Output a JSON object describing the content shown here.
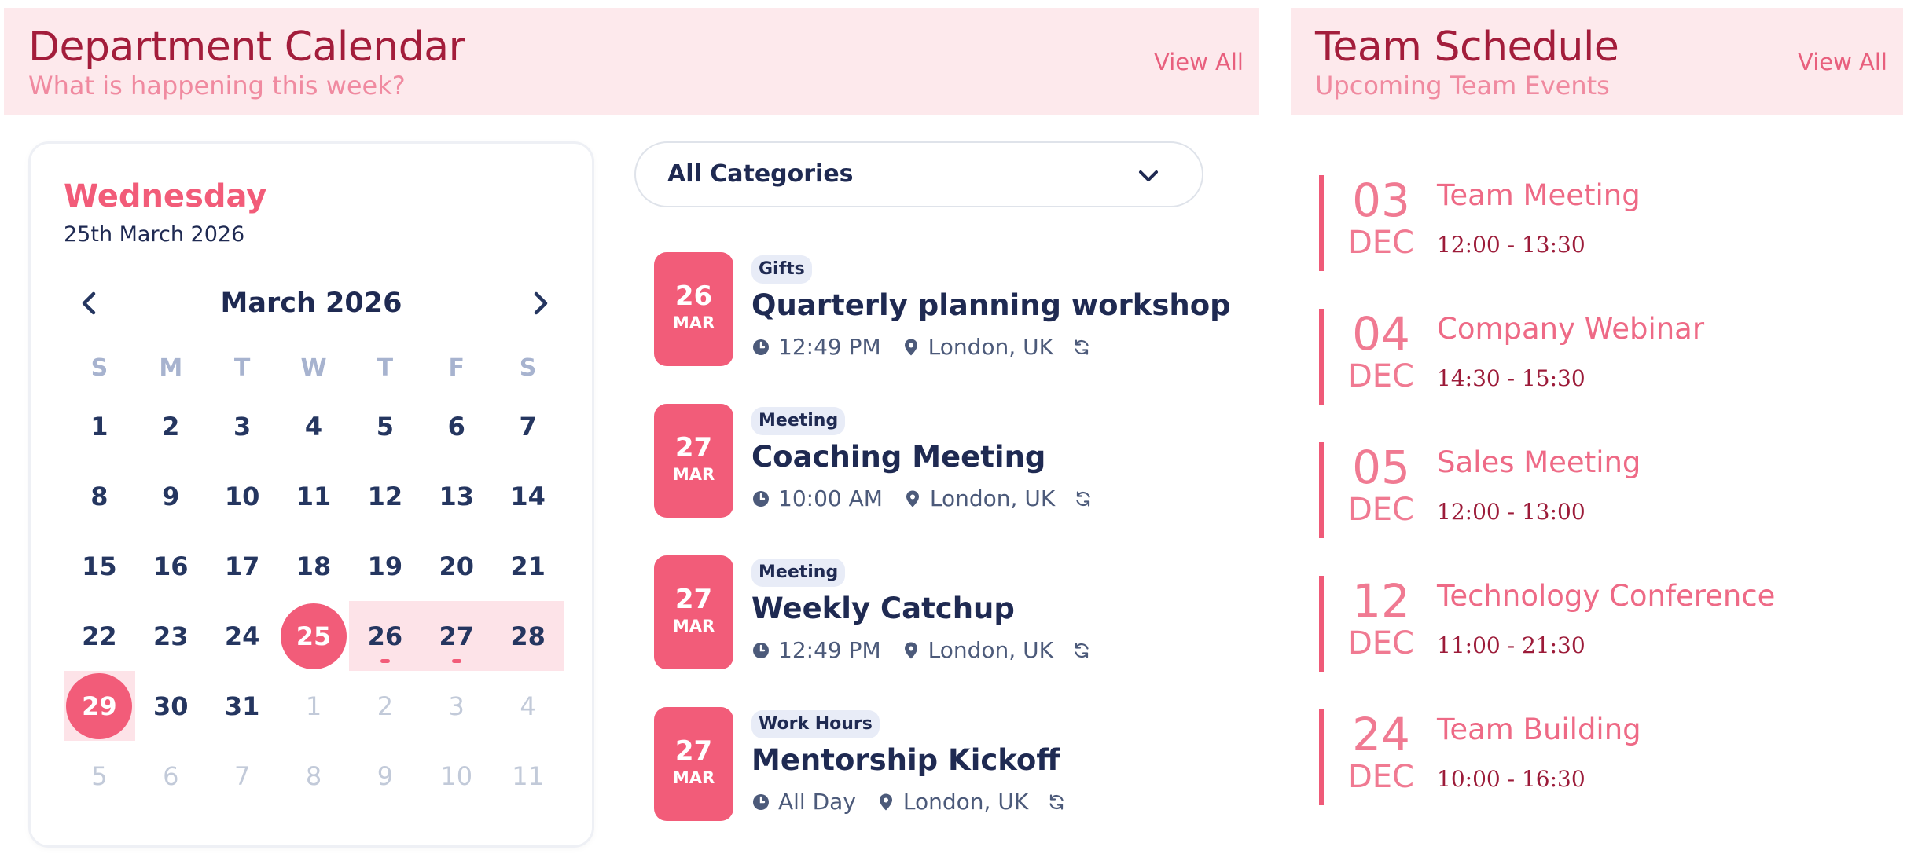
{
  "department": {
    "title": "Department Calendar",
    "subtitle": "What is happening this week?",
    "view_all": "View All"
  },
  "team": {
    "title": "Team Schedule",
    "subtitle": "Upcoming Team Events",
    "view_all": "View All"
  },
  "calendar": {
    "weekday": "Wednesday",
    "full_date": "25th March 2026",
    "month_label": "March 2026",
    "weekday_headers": [
      "S",
      "M",
      "T",
      "W",
      "T",
      "F",
      "S"
    ],
    "weeks": [
      [
        "1",
        "2",
        "3",
        "4",
        "5",
        "6",
        "7"
      ],
      [
        "8",
        "9",
        "10",
        "11",
        "12",
        "13",
        "14"
      ],
      [
        "15",
        "16",
        "17",
        "18",
        "19",
        "20",
        "21"
      ],
      [
        "22",
        "23",
        "24",
        "25",
        "26",
        "27",
        "28"
      ],
      [
        "29",
        "30",
        "31",
        "1",
        "2",
        "3",
        "4"
      ],
      [
        "5",
        "6",
        "7",
        "8",
        "9",
        "10",
        "11"
      ]
    ]
  },
  "filter": {
    "selected": "All Categories"
  },
  "events": [
    {
      "day": "26",
      "month": "MAR",
      "tag": "Gifts",
      "title": "Quarterly planning workshop",
      "time": "12:49 PM",
      "location": "London, UK"
    },
    {
      "day": "27",
      "month": "MAR",
      "tag": "Meeting",
      "title": "Coaching Meeting",
      "time": "10:00 AM",
      "location": "London, UK"
    },
    {
      "day": "27",
      "month": "MAR",
      "tag": "Meeting",
      "title": "Weekly Catchup",
      "time": "12:49 PM",
      "location": "London, UK"
    },
    {
      "day": "27",
      "month": "MAR",
      "tag": "Work Hours",
      "title": "Mentorship Kickoff",
      "time": "All Day",
      "location": "London, UK"
    }
  ],
  "schedule": [
    {
      "day": "03",
      "month": "DEC",
      "title": "Team Meeting",
      "time": "12:00 - 13:30"
    },
    {
      "day": "04",
      "month": "DEC",
      "title": "Company Webinar",
      "time": "14:30 - 15:30"
    },
    {
      "day": "05",
      "month": "DEC",
      "title": "Sales Meeting",
      "time": "12:00 - 13:00"
    },
    {
      "day": "12",
      "month": "DEC",
      "title": "Technology Conference",
      "time": "11:00 - 21:30"
    },
    {
      "day": "24",
      "month": "DEC",
      "title": "Team Building",
      "time": "10:00 - 16:30"
    }
  ],
  "colors": {
    "accent": "#f25c79",
    "header_bg": "#fde9ec",
    "range_bg": "#fde3e8",
    "navy": "#1f2a52"
  }
}
